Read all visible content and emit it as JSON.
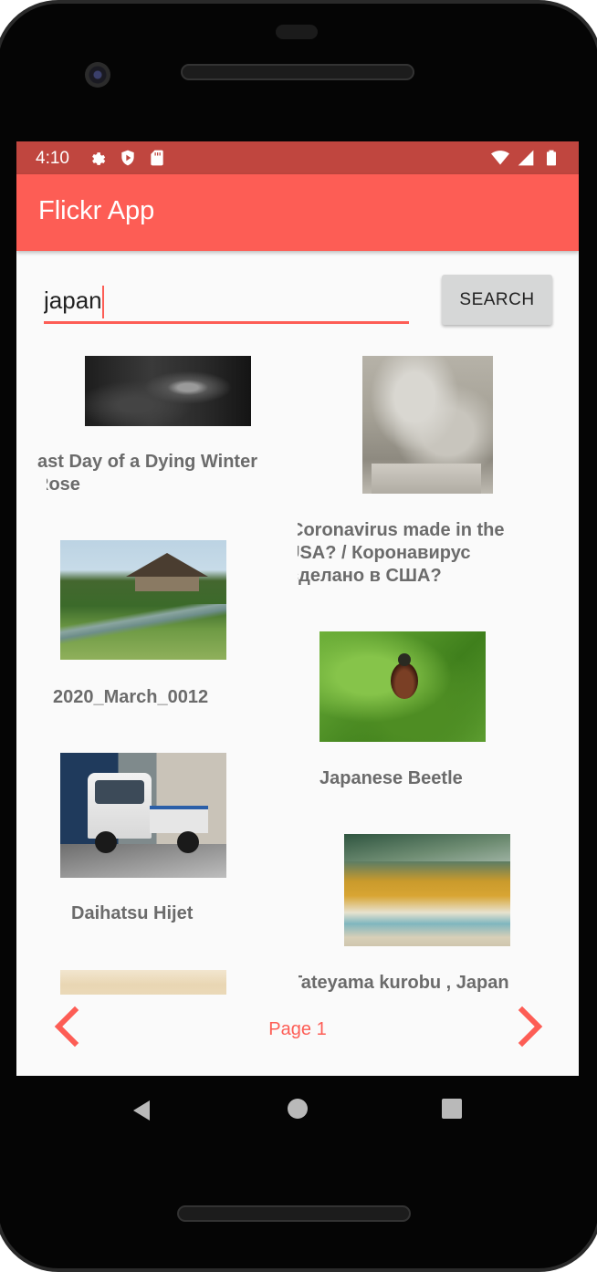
{
  "status_bar": {
    "time": "4:10",
    "left_icons": [
      "gear-icon",
      "shield-play-icon",
      "sd-card-icon"
    ],
    "right_icons": [
      "wifi-icon",
      "signal-icon",
      "battery-icon"
    ],
    "bg_color": "#c0463f"
  },
  "app_bar": {
    "title": "Flickr App",
    "bg_color": "#fd5d55"
  },
  "search": {
    "value": "japan",
    "placeholder": "",
    "button_label": "SEARCH"
  },
  "photos": [
    {
      "title_line1": "ast Day of a Dying Winter",
      "title_line2": "Rose"
    },
    {
      "title_line1": "Coronavirus made in the",
      "title_line2": "USA? / Коронавирус",
      "title_line3": "сделано в США?"
    },
    {
      "title": "2020_March_0012"
    },
    {
      "title": "Japanese Beetle"
    },
    {
      "title": "Daihatsu Hijet"
    },
    {
      "title": "Tateyama kurobu , Japan"
    },
    {
      "title": ""
    }
  ],
  "pagination": {
    "label": "Page 1",
    "prev_icon": "chevron-left-icon",
    "next_icon": "chevron-right-icon",
    "accent_color": "#fd5d55"
  },
  "system_nav": {
    "buttons": [
      "back-icon",
      "home-icon",
      "recents-icon"
    ]
  }
}
